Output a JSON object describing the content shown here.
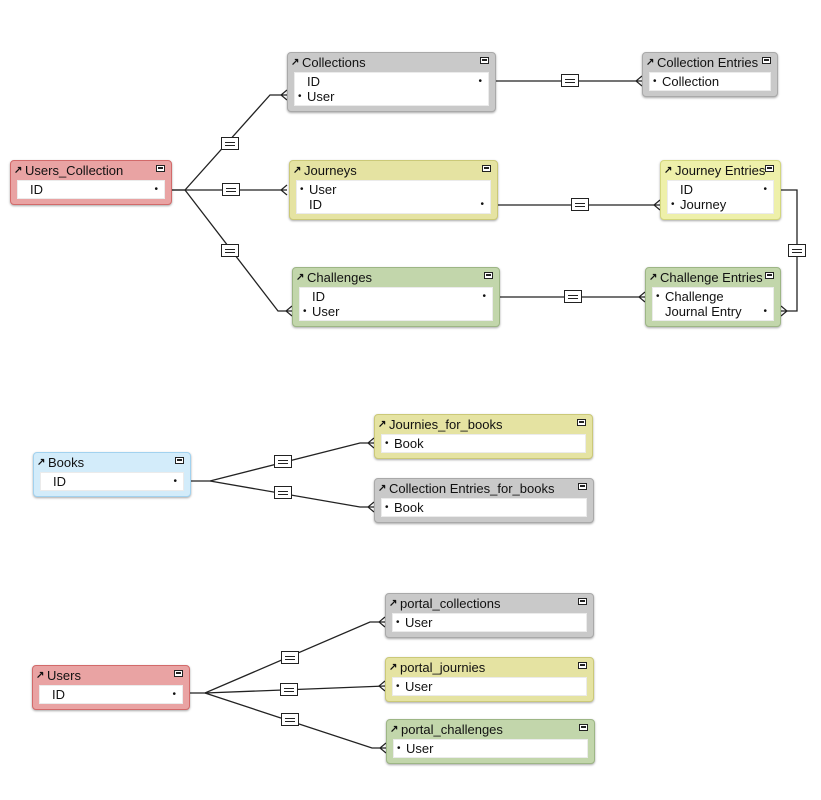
{
  "colors": {
    "gray": {
      "head": "#c9c9c9",
      "border": "#a9a9a9"
    },
    "red": {
      "head": "#e9a3a3",
      "border": "#d26a6a"
    },
    "yellow": {
      "head": "#e5e3a2",
      "border": "#cbc978"
    },
    "lightyellow": {
      "head": "#eef0aa",
      "border": "#d3d77e"
    },
    "green": {
      "head": "#c2d6ab",
      "border": "#9db685"
    },
    "blue": {
      "head": "#d3ecfa",
      "border": "#a2d2ef"
    }
  },
  "tables": [
    {
      "name": "Users_Collection",
      "color": "red",
      "fields": [
        {
          "name": "ID",
          "right_dot": true
        }
      ]
    },
    {
      "name": "Collections",
      "color": "gray",
      "fields": [
        {
          "name": "ID",
          "right_dot": true
        },
        {
          "name": "User",
          "left_dot": true
        }
      ]
    },
    {
      "name": "Collection Entries",
      "color": "gray",
      "fields": [
        {
          "name": "Collection",
          "left_dot": true
        }
      ]
    },
    {
      "name": "Journeys",
      "color": "yellow",
      "fields": [
        {
          "name": "User",
          "left_dot": true
        },
        {
          "name": "ID",
          "right_dot": true
        }
      ]
    },
    {
      "name": "Journey Entries",
      "color": "lightyellow",
      "fields": [
        {
          "name": "ID",
          "right_dot": true
        },
        {
          "name": "Journey",
          "left_dot": true
        }
      ]
    },
    {
      "name": "Challenges",
      "color": "green",
      "fields": [
        {
          "name": "ID",
          "right_dot": true
        },
        {
          "name": "User",
          "left_dot": true
        }
      ]
    },
    {
      "name": "Challenge Entries",
      "color": "green",
      "fields": [
        {
          "name": "Challenge",
          "left_dot": true
        },
        {
          "name": "Journal Entry",
          "right_dot": true
        }
      ]
    },
    {
      "name": "Books",
      "color": "blue",
      "fields": [
        {
          "name": "ID",
          "right_dot": true
        }
      ]
    },
    {
      "name": "Journies_for_books",
      "color": "yellow",
      "fields": [
        {
          "name": "Book",
          "left_dot": true
        }
      ]
    },
    {
      "name": "Collection Entries_for_books",
      "color": "gray",
      "fields": [
        {
          "name": "Book",
          "left_dot": true
        }
      ]
    },
    {
      "name": "Users",
      "color": "red",
      "fields": [
        {
          "name": "ID",
          "right_dot": true
        }
      ]
    },
    {
      "name": "portal_collections",
      "color": "gray",
      "fields": [
        {
          "name": "User",
          "left_dot": true
        }
      ]
    },
    {
      "name": "portal_journies",
      "color": "yellow",
      "fields": [
        {
          "name": "User",
          "left_dot": true
        }
      ]
    },
    {
      "name": "portal_challenges",
      "color": "green",
      "fields": [
        {
          "name": "User",
          "left_dot": true
        }
      ]
    }
  ],
  "relationships": [
    {
      "from": "Users_Collection",
      "to": "Collections",
      "operator": "="
    },
    {
      "from": "Users_Collection",
      "to": "Journeys",
      "operator": "="
    },
    {
      "from": "Users_Collection",
      "to": "Challenges",
      "operator": "="
    },
    {
      "from": "Collections",
      "to": "Collection Entries",
      "operator": "="
    },
    {
      "from": "Journeys",
      "to": "Journey Entries",
      "operator": "="
    },
    {
      "from": "Challenges",
      "to": "Challenge Entries",
      "operator": "="
    },
    {
      "from": "Journey Entries",
      "to": "Challenge Entries",
      "operator": "="
    },
    {
      "from": "Books",
      "to": "Journies_for_books",
      "operator": "="
    },
    {
      "from": "Books",
      "to": "Collection Entries_for_books",
      "operator": "="
    },
    {
      "from": "Users",
      "to": "portal_collections",
      "operator": "="
    },
    {
      "from": "Users",
      "to": "portal_journies",
      "operator": "="
    },
    {
      "from": "Users",
      "to": "portal_challenges",
      "operator": "="
    }
  ]
}
